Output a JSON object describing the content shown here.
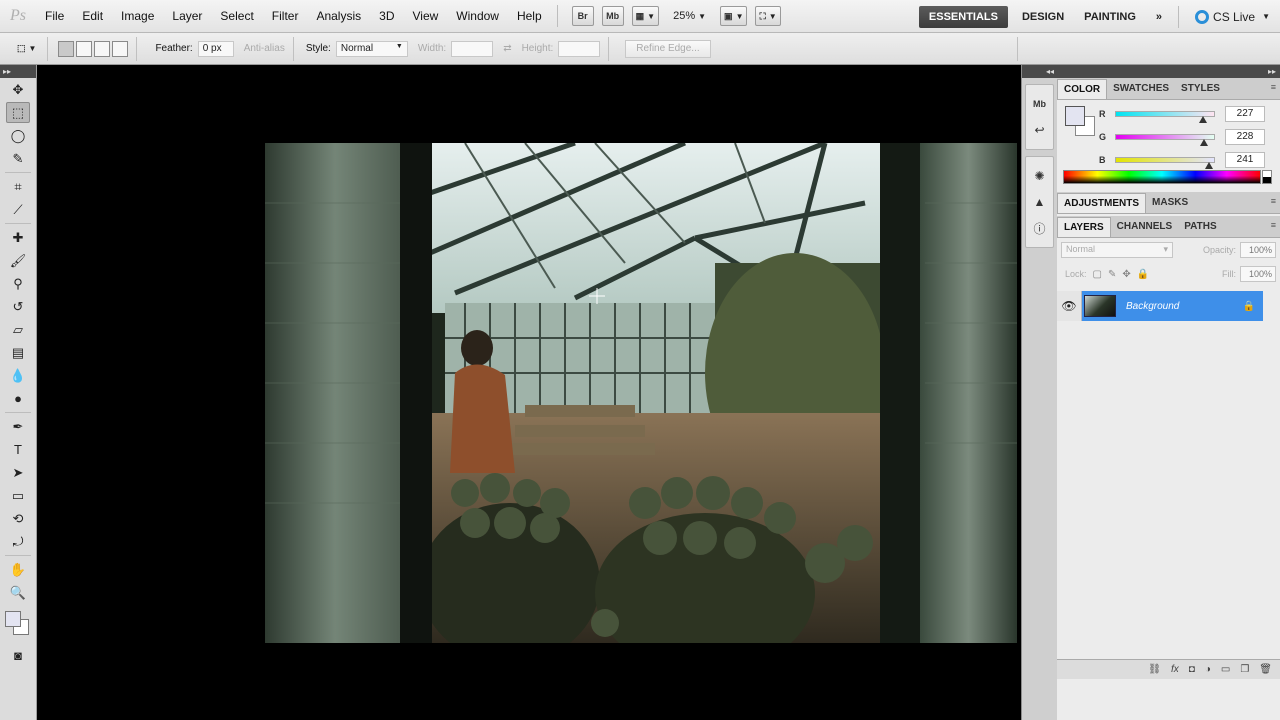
{
  "app": {
    "logo": "Ps"
  },
  "menu": [
    "File",
    "Edit",
    "Image",
    "Layer",
    "Select",
    "Filter",
    "Analysis",
    "3D",
    "View",
    "Window",
    "Help"
  ],
  "menubar_icons": {
    "bridge": "Br",
    "mini_bridge": "Mb"
  },
  "zoom": "25%",
  "workspaces": {
    "essentials": "ESSENTIALS",
    "design": "DESIGN",
    "painting": "PAINTING",
    "more": "»"
  },
  "cs_live": "CS Live",
  "options": {
    "feather_label": "Feather:",
    "feather_value": "0 px",
    "antialias_label": "Anti-alias",
    "style_label": "Style:",
    "style_value": "Normal",
    "width_label": "Width:",
    "height_label": "Height:",
    "refine_edge": "Refine Edge..."
  },
  "tools": [
    {
      "name": "move-tool-icon",
      "glyph": "✥"
    },
    {
      "name": "rectangular-marquee-tool-icon",
      "glyph": "⬚",
      "active": true
    },
    {
      "name": "lasso-tool-icon",
      "glyph": "◯"
    },
    {
      "name": "quick-selection-tool-icon",
      "glyph": "✎"
    },
    {
      "name": "crop-tool-icon",
      "glyph": "⌗"
    },
    {
      "name": "eyedropper-tool-icon",
      "glyph": "⟋"
    },
    {
      "name": "spot-healing-brush-icon",
      "glyph": "✚"
    },
    {
      "name": "brush-tool-icon",
      "glyph": "🖌"
    },
    {
      "name": "clone-stamp-tool-icon",
      "glyph": "⚲"
    },
    {
      "name": "history-brush-icon",
      "glyph": "↺"
    },
    {
      "name": "eraser-tool-icon",
      "glyph": "▱"
    },
    {
      "name": "gradient-tool-icon",
      "glyph": "▤"
    },
    {
      "name": "blur-tool-icon",
      "glyph": "💧"
    },
    {
      "name": "dodge-tool-icon",
      "glyph": "●"
    },
    {
      "name": "pen-tool-icon",
      "glyph": "✒"
    },
    {
      "name": "type-tool-icon",
      "glyph": "T"
    },
    {
      "name": "path-selection-tool-icon",
      "glyph": "➤"
    },
    {
      "name": "rectangle-shape-tool-icon",
      "glyph": "▭"
    },
    {
      "name": "3d-rotate-tool-icon",
      "glyph": "⟲"
    },
    {
      "name": "3d-orbit-tool-icon",
      "glyph": "⤾"
    },
    {
      "name": "hand-tool-icon",
      "glyph": "✋"
    },
    {
      "name": "zoom-tool-icon",
      "glyph": "🔍"
    }
  ],
  "colors": {
    "foreground": "#e3e4f1",
    "background": "#ffffff",
    "accent": "#3e8fe9"
  },
  "color_panel": {
    "tabs": [
      "COLOR",
      "SWATCHES",
      "STYLES"
    ],
    "r_label": "R",
    "g_label": "G",
    "b_label": "B",
    "r": 227,
    "g": 228,
    "b": 241
  },
  "adjust_panel": {
    "tabs": [
      "ADJUSTMENTS",
      "MASKS"
    ]
  },
  "layers_panel": {
    "tabs": [
      "LAYERS",
      "CHANNELS",
      "PATHS"
    ],
    "blend_mode": "Normal",
    "opacity_label": "Opacity:",
    "opacity": "100%",
    "lock_label": "Lock:",
    "fill_label": "Fill:",
    "fill": "100%",
    "layer_name": "Background"
  }
}
